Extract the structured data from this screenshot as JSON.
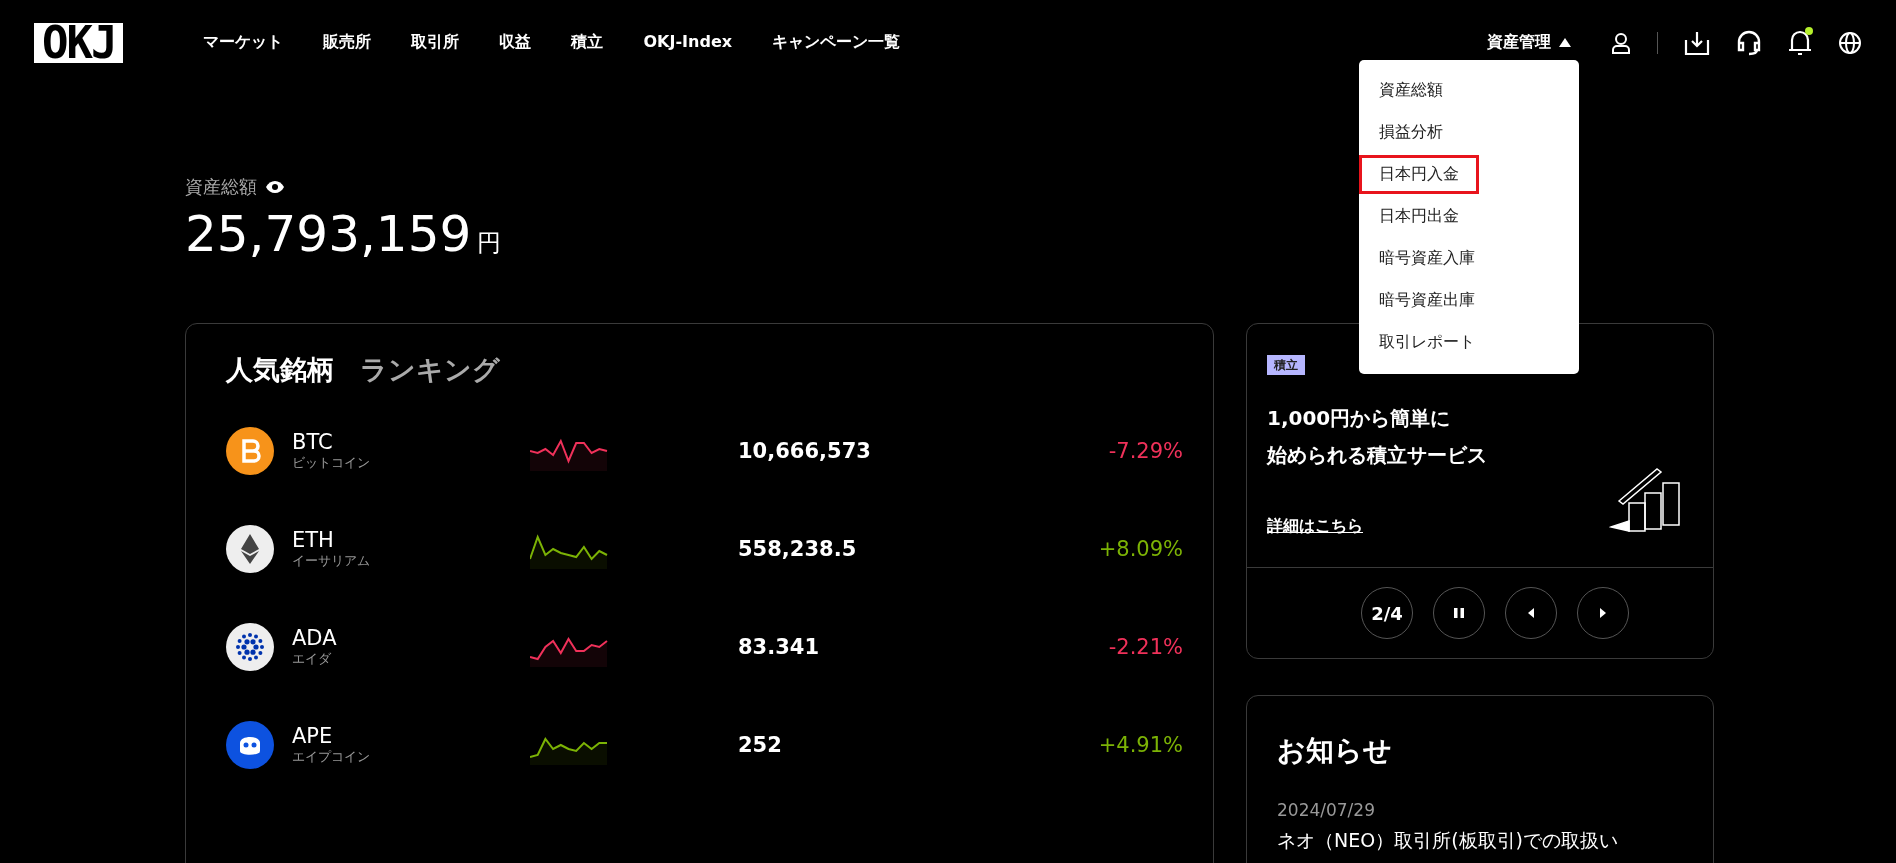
{
  "header": {
    "logo": "OKJ",
    "nav": [
      "マーケット",
      "販売所",
      "取引所",
      "収益",
      "積立",
      "OKJ-Index",
      "キャンペーン一覧"
    ],
    "asset_menu": {
      "label": "資産管理",
      "expanded": true,
      "items": [
        {
          "label": "資産総額",
          "highlighted": false
        },
        {
          "label": "損益分析",
          "highlighted": false
        },
        {
          "label": "日本円入金",
          "highlighted": true
        },
        {
          "label": "日本円出金",
          "highlighted": false
        },
        {
          "label": "暗号資産入庫",
          "highlighted": false
        },
        {
          "label": "暗号資産出庫",
          "highlighted": false
        },
        {
          "label": "取引レポート",
          "highlighted": false
        }
      ]
    },
    "notifications_unread": true
  },
  "balance": {
    "label": "資産総額",
    "visible": true,
    "amount": "25,793,159",
    "unit": "円"
  },
  "ranking": {
    "title": "人気銘柄",
    "subtitle": "ランキング",
    "rows": [
      {
        "symbol": "BTC",
        "name": "ビットコイン",
        "price": "10,666,573",
        "change": "-7.29%",
        "color": "#f0315a"
      },
      {
        "symbol": "ETH",
        "name": "イーサリアム",
        "price": "558,238.5",
        "change": "+8.09%",
        "color": "#7cb305"
      },
      {
        "symbol": "ADA",
        "name": "エイダ",
        "price": "83.341",
        "change": "-2.21%",
        "color": "#f0315a"
      },
      {
        "symbol": "APE",
        "name": "エイプコイン",
        "price": "252",
        "change": "+4.91%",
        "color": "#7cb305"
      }
    ]
  },
  "promo": {
    "tag": "積立",
    "heading": [
      "1,000円から簡単に",
      "始められる積立サービス"
    ],
    "link": "詳細はこちら",
    "counter": "2/4",
    "playing": true
  },
  "news": {
    "title": "お知らせ",
    "items": [
      {
        "date": "2024/07/29",
        "title": "ネオ（NEO）取引所(板取引)での取扱い"
      }
    ]
  }
}
